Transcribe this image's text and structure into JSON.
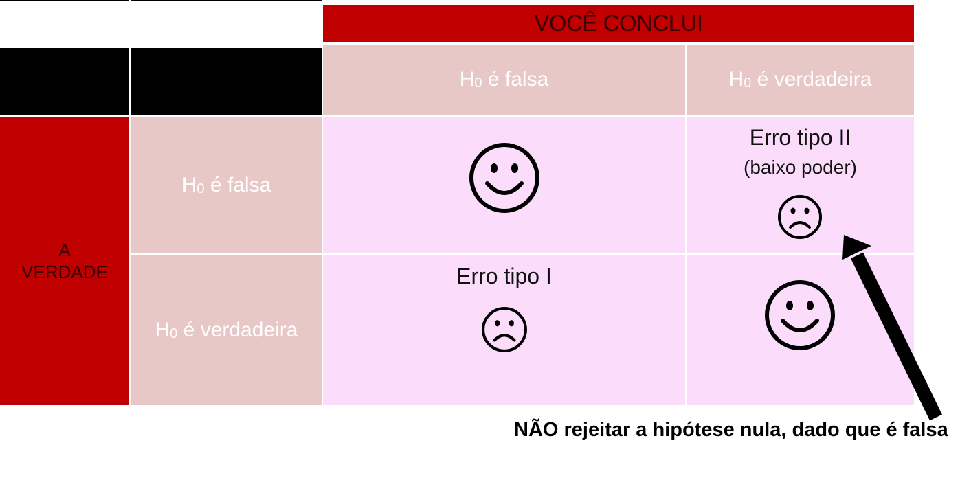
{
  "header": {
    "conclusion_label": "VOCÊ CONCLUI",
    "truth_label_line1": "A",
    "truth_label_line2": "VERDADE"
  },
  "columns": [
    {
      "h": "H",
      "sub": "0",
      "rest": " é falsa"
    },
    {
      "h": "H",
      "sub": "0",
      "rest": " é verdadeira"
    }
  ],
  "rows": [
    {
      "h": "H",
      "sub": "0",
      "rest": " é falsa"
    },
    {
      "h": "H",
      "sub": "0",
      "rest": " é verdadeira"
    }
  ],
  "cells": {
    "r1c2_title": "Erro tipo II",
    "r1c2_sub": "(baixo poder)",
    "r2c1_title": "Erro tipo I"
  },
  "faces": {
    "r1c1": "happy-face-icon",
    "r1c2": "sad-face-icon",
    "r2c1": "sad-face-icon",
    "r2c2": "happy-face-icon"
  },
  "caption": "NÃO rejeitar a hipótese nula, dado que é falsa",
  "colors": {
    "red": "#c00000",
    "pink_header": "#e8c7c7",
    "cell_bg": "#fbdcfb"
  }
}
